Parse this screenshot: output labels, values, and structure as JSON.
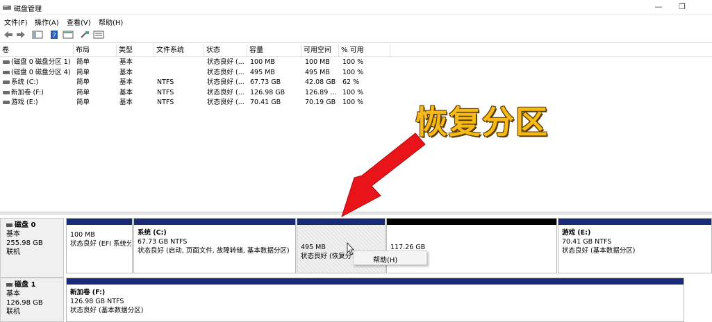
{
  "window": {
    "title": "磁盘管理",
    "minimize_icon": "minimize-icon",
    "restore_icon": "restore-icon"
  },
  "menu": [
    "文件(F)",
    "操作(A)",
    "查看(V)",
    "帮助(H)"
  ],
  "volume_list": {
    "columns": [
      "卷",
      "布局",
      "类型",
      "文件系统",
      "状态",
      "容量",
      "可用空间",
      "% 可用"
    ],
    "rows": [
      [
        "(磁盘 0 磁盘分区 1)",
        "简单",
        "基本",
        "",
        "状态良好 (...",
        "100 MB",
        "100 MB",
        "100 %"
      ],
      [
        "(磁盘 0 磁盘分区 4)",
        "简单",
        "基本",
        "",
        "状态良好 (...",
        "495 MB",
        "495 MB",
        "100 %"
      ],
      [
        "系统 (C:)",
        "简单",
        "基本",
        "NTFS",
        "状态良好 (...",
        "67.73 GB",
        "42.08 GB",
        "62 %"
      ],
      [
        "新加卷 (F:)",
        "简单",
        "基本",
        "NTFS",
        "状态良好 (...",
        "126.98 GB",
        "126.89 ...",
        "100 %"
      ],
      [
        "游戏 (E:)",
        "简单",
        "基本",
        "NTFS",
        "状态良好 (...",
        "70.41 GB",
        "70.19 GB",
        "100 %"
      ]
    ]
  },
  "annotation": {
    "text": "恢复分区",
    "color": "#f7b918"
  },
  "disks": [
    {
      "name": "磁盘 0",
      "type": "基本",
      "size": "255.98 GB",
      "state": "联机",
      "partitions": [
        {
          "name": "",
          "size": "100 MB",
          "status": "状态良好 (EFI 系统分"
        },
        {
          "name": "系统  (C:)",
          "size": "67.73 GB NTFS",
          "status": "状态良好 (启动, 页面文件, 故障转储, 基本数据分区)"
        },
        {
          "name": "",
          "size": "495 MB",
          "status": "状态良好 (恢复分"
        },
        {
          "name": "",
          "size": "117.26 GB",
          "status": ""
        },
        {
          "name": "游戏  (E:)",
          "size": "70.41 GB NTFS",
          "status": "状态良好 (基本数据分区)"
        }
      ]
    },
    {
      "name": "磁盘 1",
      "type": "基本",
      "size": "126.98 GB",
      "state": "联机",
      "partitions": [
        {
          "name": "新加卷  (F:)",
          "size": "126.98 GB NTFS",
          "status": "状态良好 (基本数据分区)"
        }
      ]
    }
  ],
  "context_menu": {
    "items": [
      "帮助(H)"
    ]
  },
  "colors": {
    "partition_bar": "#1a2a7a",
    "unallocated_bar": "#000000",
    "arrow": "#e8141a"
  }
}
